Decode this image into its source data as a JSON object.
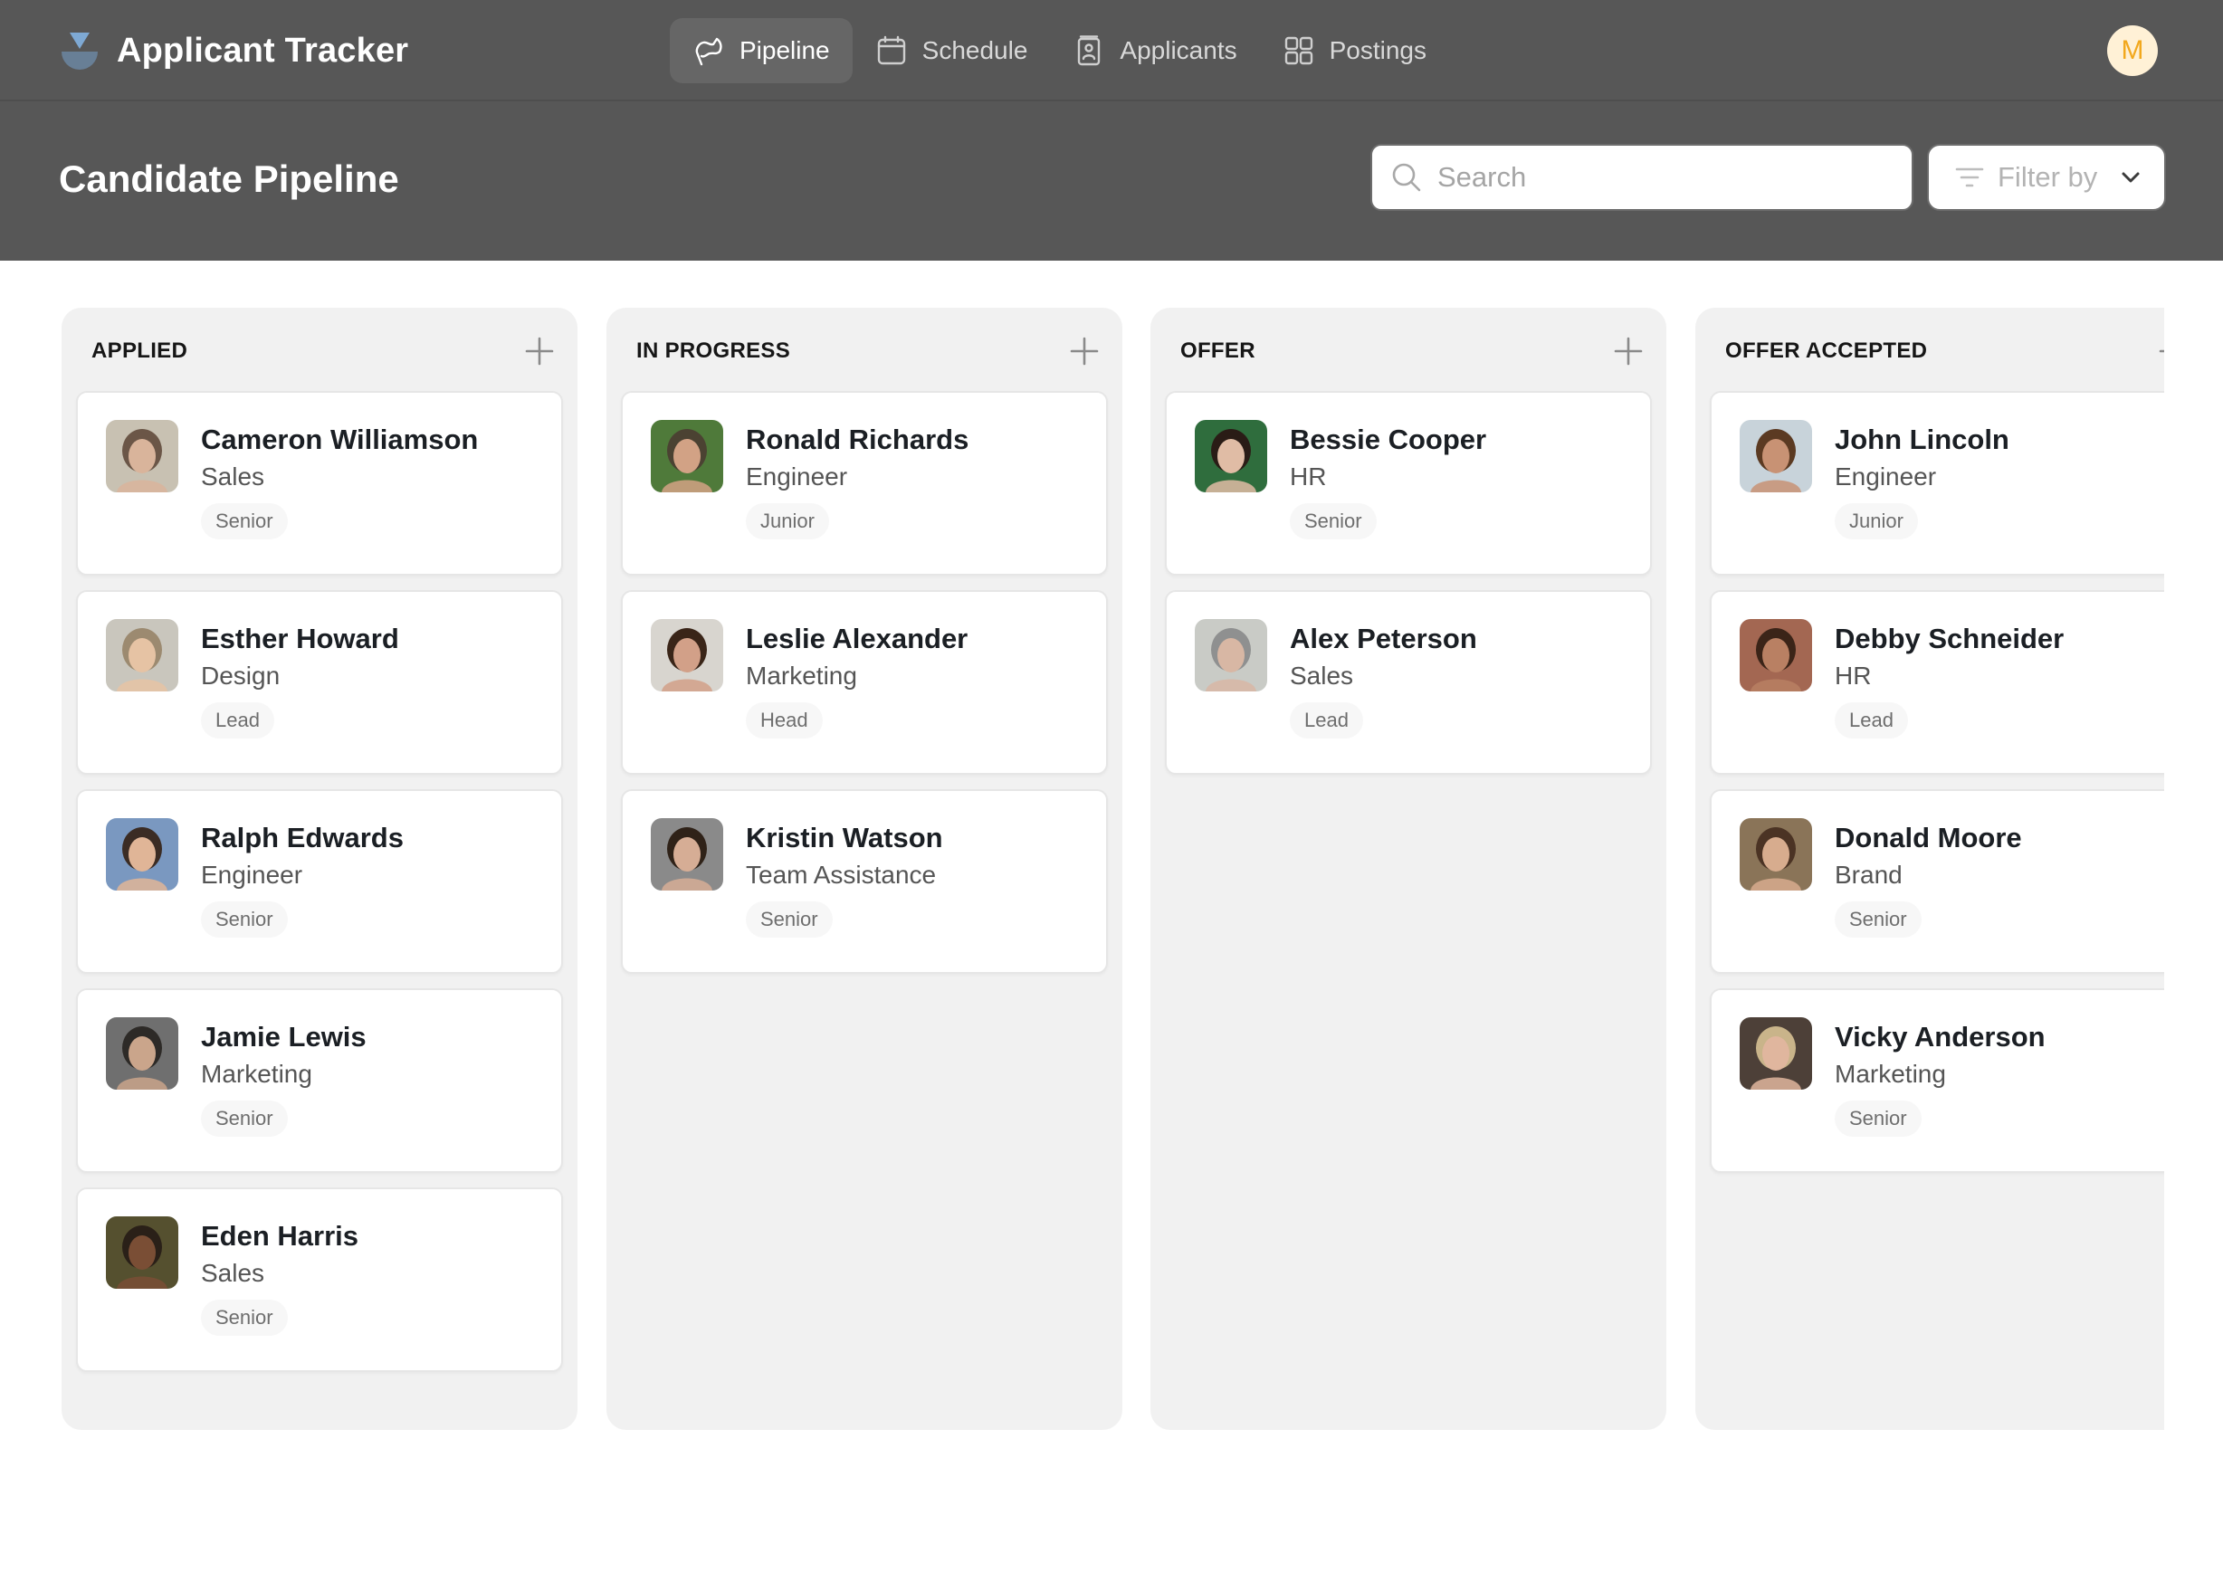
{
  "app": {
    "title": "Applicant Tracker",
    "user_initial": "M"
  },
  "colors": {
    "nav_bg": "#575757",
    "nav_active_bg": "#666666",
    "logo_top": "#7ea9d4",
    "logo_bottom": "#687f96",
    "avatar_bg": "#fff1d6",
    "avatar_text": "#f2a81d",
    "column_bg": "#f1f1f1"
  },
  "nav": {
    "items": [
      {
        "label": "Pipeline",
        "icon": "flag-icon",
        "active": true
      },
      {
        "label": "Schedule",
        "icon": "calendar-icon",
        "active": false
      },
      {
        "label": "Applicants",
        "icon": "id-badge-icon",
        "active": false
      },
      {
        "label": "Postings",
        "icon": "grid-icon",
        "active": false
      }
    ]
  },
  "header": {
    "title": "Candidate Pipeline",
    "search_placeholder": "Search",
    "search_value": "",
    "filter_label": "Filter by"
  },
  "columns": [
    {
      "title": "APPLIED",
      "cards": [
        {
          "name": "Cameron Williamson",
          "dept": "Sales",
          "level": "Senior"
        },
        {
          "name": "Esther Howard",
          "dept": "Design",
          "level": "Lead"
        },
        {
          "name": "Ralph Edwards",
          "dept": "Engineer",
          "level": "Senior"
        },
        {
          "name": "Jamie Lewis",
          "dept": "Marketing",
          "level": "Senior"
        },
        {
          "name": "Eden Harris",
          "dept": "Sales",
          "level": "Senior"
        }
      ]
    },
    {
      "title": "IN PROGRESS",
      "cards": [
        {
          "name": "Ronald Richards",
          "dept": "Engineer",
          "level": "Junior"
        },
        {
          "name": "Leslie Alexander",
          "dept": "Marketing",
          "level": "Head"
        },
        {
          "name": "Kristin Watson",
          "dept": "Team Assistance",
          "level": "Senior"
        }
      ]
    },
    {
      "title": "OFFER",
      "cards": [
        {
          "name": "Bessie Cooper",
          "dept": "HR",
          "level": "Senior"
        },
        {
          "name": "Alex Peterson",
          "dept": "Sales",
          "level": "Lead"
        }
      ]
    },
    {
      "title": "OFFER ACCEPTED",
      "cards": [
        {
          "name": "John Lincoln",
          "dept": "Engineer",
          "level": "Junior"
        },
        {
          "name": "Debby Schneider",
          "dept": "HR",
          "level": "Lead"
        },
        {
          "name": "Donald Moore",
          "dept": "Brand",
          "level": "Senior"
        },
        {
          "name": "Vicky Anderson",
          "dept": "Marketing",
          "level": "Senior"
        }
      ]
    }
  ]
}
